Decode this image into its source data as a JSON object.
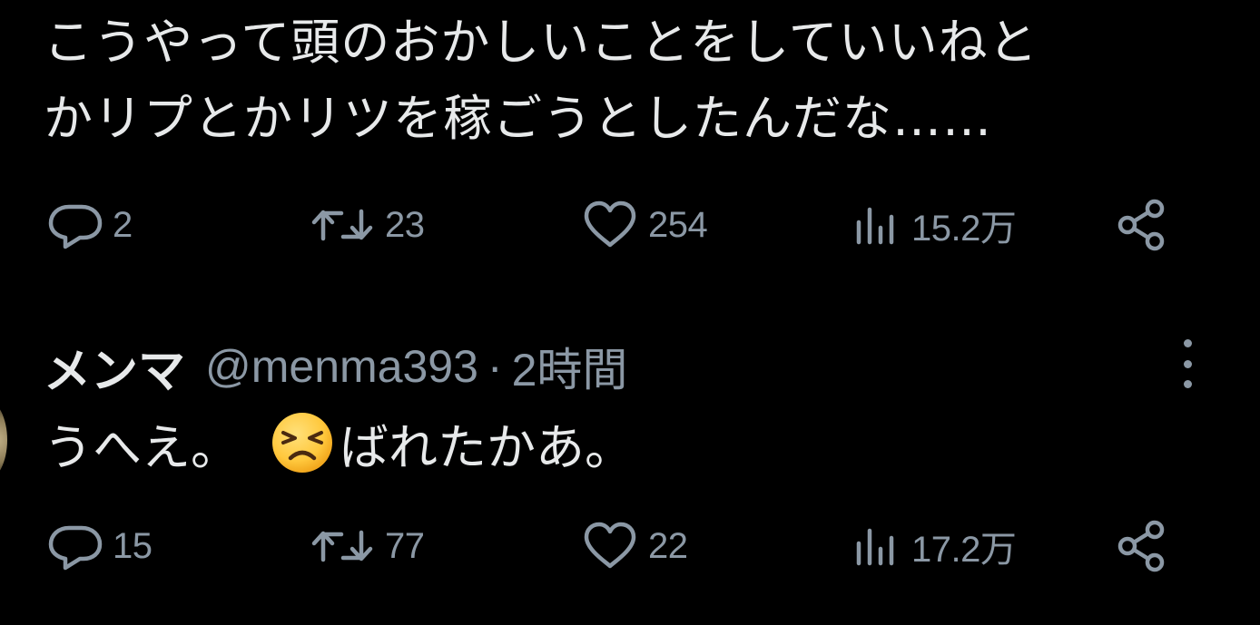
{
  "tweet": {
    "text_line1": "こうやって頭のおかしいことをしていいねと",
    "text_line2": "かリプとかリツを稼ごうとしたんだな……",
    "stats": {
      "replies": "2",
      "retweets": "23",
      "likes": "254",
      "views": "15.2万"
    }
  },
  "reply": {
    "display_name": "メンマ",
    "handle": "@menma393",
    "separator": "·",
    "time": "2時間",
    "text_before_emoji": "うへえ。",
    "emoji": "persevering-face-emoji",
    "text_after_emoji": "ばれたかあ。",
    "stats": {
      "replies": "15",
      "retweets": "77",
      "likes": "22",
      "views": "17.2万"
    }
  },
  "icons": {
    "reply": "reply-icon",
    "retweet": "retweet-icon",
    "like": "heart-icon",
    "views": "views-icon",
    "share": "share-icon",
    "more": "more-icon"
  },
  "colors": {
    "background": "#000000",
    "text": "#e7e9ea",
    "secondary": "#8b98a5",
    "emoji": "#ffc83d"
  }
}
